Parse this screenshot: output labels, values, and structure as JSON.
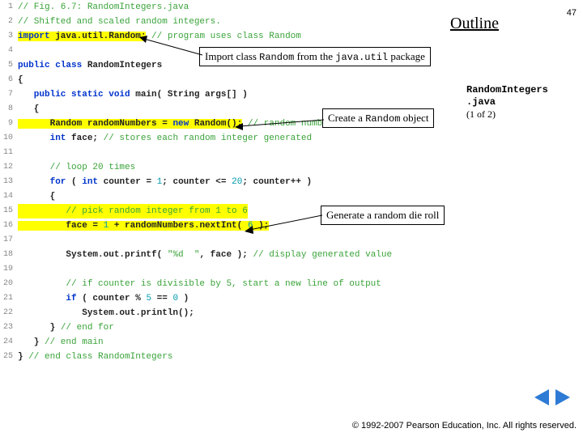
{
  "pageNumber": "47",
  "outlineTitle": "Outline",
  "fileInfo": {
    "name": "RandomIntegers",
    "ext": ".java",
    "part": "(1 of 2)"
  },
  "callouts": {
    "c1_prefix": "Import class ",
    "c1_code1": "Random",
    "c1_mid": " from the ",
    "c1_code2": "java.util",
    "c1_suffix": " package",
    "c2_prefix": "Create a ",
    "c2_code": "Random",
    "c2_suffix": " object",
    "c3": "Generate a random die roll"
  },
  "copyright": "© 1992-2007 Pearson Education, Inc. All rights reserved.",
  "code": {
    "l1": "// Fig. 6.7: RandomIntegers.java",
    "l2": "// Shifted and scaled random integers.",
    "l3a": "import",
    "l3b": " java.util.Random;",
    "l3c": " // program uses class Random",
    "l5a": "public class",
    "l5b": " RandomIntegers",
    "l6": "{",
    "l7a": "   public static void",
    "l7b": " main( String args[] )",
    "l8": "   {",
    "l9a": "      Random randomNumbers = ",
    "l9b": "new",
    "l9c": " Random();",
    "l9d": " // random number generator",
    "l10a": "      int",
    "l10b": " face;",
    "l10c": " // stores each random integer generated",
    "l12": "      // loop 20 times",
    "l13a": "      for",
    "l13b": " ( ",
    "l13c": "int",
    "l13d": " counter = ",
    "l13e": "1",
    "l13f": "; counter <= ",
    "l13g": "20",
    "l13h": "; counter++ )",
    "l14": "      {",
    "l15": "         // pick random integer from 1 to 6",
    "l16a": "         face = ",
    "l16b": "1",
    "l16c": " + randomNumbers.nextInt( ",
    "l16d": "6",
    "l16e": " );",
    "l18a": "         System.out.printf( ",
    "l18b": "\"%d  \"",
    "l18c": ", face );",
    "l18d": " // display generated value",
    "l20": "         // if counter is divisible by 5, start a new line of output",
    "l21a": "         if",
    "l21b": " ( counter % ",
    "l21c": "5",
    "l21d": " == ",
    "l21e": "0",
    "l21f": " )",
    "l22": "            System.out.println();",
    "l23a": "      }",
    "l23b": " // end for",
    "l24a": "   }",
    "l24b": " // end main",
    "l25a": "}",
    "l25b": " // end class RandomIntegers"
  }
}
